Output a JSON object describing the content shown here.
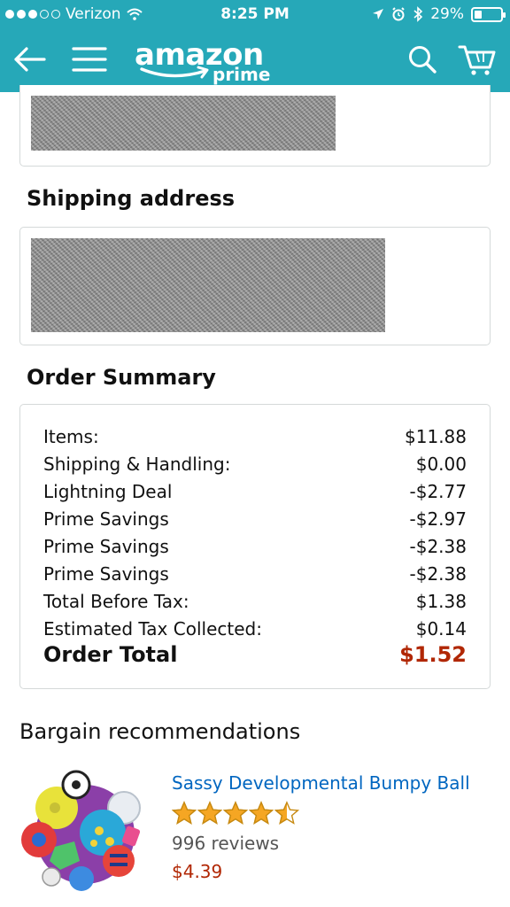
{
  "status_bar": {
    "carrier": "Verizon",
    "time": "8:25 PM",
    "battery": "29%",
    "battery_level": 0.29
  },
  "nav": {
    "logo_word": "amazon",
    "logo_sub": "prime",
    "icons": [
      "back-arrow-icon",
      "menu-icon",
      "search-icon",
      "cart-icon"
    ]
  },
  "shipping": {
    "title": "Shipping address"
  },
  "order_summary": {
    "title": "Order Summary",
    "rows": [
      {
        "label": "Items:",
        "value": "$11.88"
      },
      {
        "label": "Shipping & Handling:",
        "value": "$0.00"
      },
      {
        "label": "Lightning Deal",
        "value": "-$2.77"
      },
      {
        "label": "Prime Savings",
        "value": "-$2.97"
      },
      {
        "label": "Prime Savings",
        "value": "-$2.38"
      },
      {
        "label": "Prime Savings",
        "value": "-$2.38"
      },
      {
        "label": "Total Before Tax:",
        "value": "$1.38"
      },
      {
        "label": "Estimated Tax Collected:",
        "value": "$0.14"
      }
    ],
    "total_label": "Order Total",
    "total_value": "$1.52"
  },
  "recommendations": {
    "heading": "Bargain recommendations",
    "items": [
      {
        "title": "Sassy Developmental Bumpy Ball",
        "rating": 4.5,
        "reviews": "996 reviews",
        "price": "$4.39"
      }
    ]
  },
  "colors": {
    "header": "#26a8b8",
    "link": "#0066c0",
    "price": "#b12704",
    "star": "#f5a623"
  }
}
